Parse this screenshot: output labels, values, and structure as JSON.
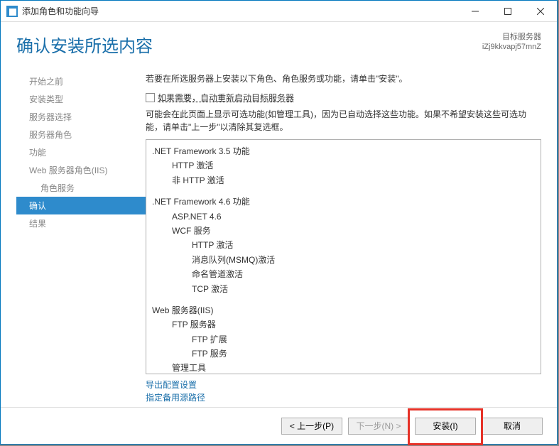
{
  "window": {
    "title": "添加角色和功能向导"
  },
  "header": {
    "page_title": "确认安装所选内容",
    "server_label": "目标服务器",
    "server_name": "iZj9kkvapj57mnZ"
  },
  "nav": {
    "items": [
      {
        "label": "开始之前"
      },
      {
        "label": "安装类型"
      },
      {
        "label": "服务器选择"
      },
      {
        "label": "服务器角色"
      },
      {
        "label": "功能"
      },
      {
        "label": "Web 服务器角色(IIS)"
      },
      {
        "label": "角色服务",
        "sub": true
      },
      {
        "label": "确认",
        "active": true
      },
      {
        "label": "结果"
      }
    ]
  },
  "main": {
    "instruction": "若要在所选服务器上安装以下角色、角色服务或功能，请单击\"安装\"。",
    "checkbox_label": "如果需要，自动重新启动目标服务器",
    "warn_text": "可能会在此页面上显示可选功能(如管理工具)，因为已自动选择这些功能。如果不希望安装这些可选功能，请单击\"上一步\"以清除其复选框。",
    "tree": [
      {
        "level": 0,
        "text": ".NET Framework 3.5 功能"
      },
      {
        "level": 1,
        "text": "HTTP 激活"
      },
      {
        "level": 1,
        "text": "非 HTTP 激活"
      },
      {
        "level": 0,
        "text": ".NET Framework 4.6 功能"
      },
      {
        "level": 1,
        "text": "ASP.NET 4.6"
      },
      {
        "level": 1,
        "text": "WCF 服务"
      },
      {
        "level": 2,
        "text": "HTTP 激活"
      },
      {
        "level": 2,
        "text": "消息队列(MSMQ)激活"
      },
      {
        "level": 2,
        "text": "命名管道激活"
      },
      {
        "level": 2,
        "text": "TCP 激活"
      },
      {
        "level": 0,
        "text": "Web 服务器(IIS)"
      },
      {
        "level": 1,
        "text": "FTP 服务器"
      },
      {
        "level": 2,
        "text": "FTP 扩展"
      },
      {
        "level": 2,
        "text": "FTP 服务"
      },
      {
        "level": 1,
        "text": "管理工具"
      }
    ],
    "links": {
      "export": "导出配置设置",
      "altsrc": "指定备用源路径"
    }
  },
  "buttons": {
    "prev": "< 上一步(P)",
    "next": "下一步(N) >",
    "install": "安装(I)",
    "cancel": "取消"
  }
}
